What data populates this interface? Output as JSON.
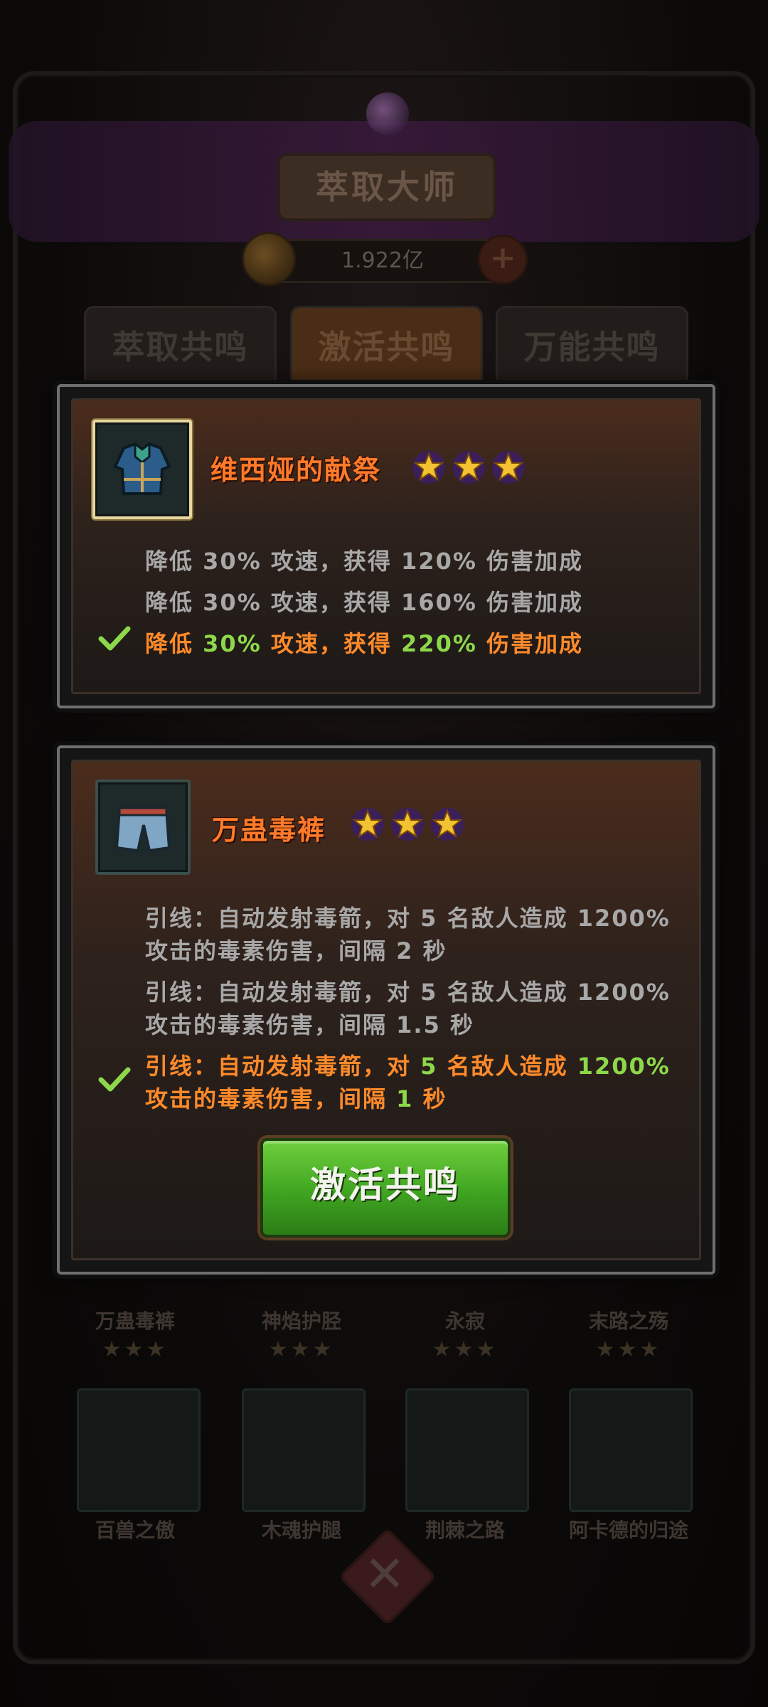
{
  "header": {
    "title": "萃取大师",
    "currency": "1.922亿"
  },
  "tabs": [
    {
      "label": "萃取共鸣",
      "active": false
    },
    {
      "label": "激活共鸣",
      "active": true
    },
    {
      "label": "万能共鸣",
      "active": false
    }
  ],
  "card1": {
    "item_name": "维西娅的献祭",
    "stars": 3,
    "options": [
      {
        "parts": [
          {
            "t": "降低 "
          },
          {
            "t": "30%"
          },
          {
            "t": " 攻速，获得 "
          },
          {
            "t": "120%"
          },
          {
            "t": " 伤害加成"
          }
        ],
        "selected": false
      },
      {
        "parts": [
          {
            "t": "降低 "
          },
          {
            "t": "30%"
          },
          {
            "t": " 攻速，获得 "
          },
          {
            "t": "160%"
          },
          {
            "t": " 伤害加成"
          }
        ],
        "selected": false
      },
      {
        "parts": [
          {
            "t": "降低 "
          },
          {
            "t": "30%"
          },
          {
            "t": " 攻速，获得 "
          },
          {
            "t": "220%"
          },
          {
            "t": " 伤害加成"
          }
        ],
        "selected": true
      }
    ]
  },
  "card2": {
    "item_name": "万蛊毒裤",
    "stars": 3,
    "options": [
      {
        "line1_a": "引线：自动发射毒箭，对 ",
        "n1": "5",
        "line1_b": " 名敌人造成 ",
        "n2": "1200%",
        "line2_a": "攻击的毒素伤害，间隔 ",
        "n3": "2",
        "line2_b": " 秒",
        "selected": false
      },
      {
        "line1_a": "引线：自动发射毒箭，对 ",
        "n1": "5",
        "line1_b": " 名敌人造成 ",
        "n2": "1200%",
        "line2_a": "攻击的毒素伤害，间隔 ",
        "n3": "1.5",
        "line2_b": " 秒",
        "selected": false
      },
      {
        "line1_a": "引线：自动发射毒箭，对 ",
        "n1": "5",
        "line1_b": " 名敌人造成 ",
        "n2": "1200%",
        "line2_a": "攻击的毒素伤害，间隔 ",
        "n3": "1",
        "line2_b": " 秒",
        "selected": true
      }
    ],
    "button_label": "激活共鸣"
  },
  "grid": {
    "row1": [
      "万蛊毒裤",
      "神焰护胫",
      "永寂",
      "末路之殇"
    ],
    "row2": [
      "百兽之傲",
      "木魂护腿",
      "荆棘之路",
      "阿卡德的归途"
    ]
  },
  "colors": {
    "accent_orange": "#ff7a2a",
    "value_green": "#8dd84a",
    "button_green": "#3fa421"
  }
}
